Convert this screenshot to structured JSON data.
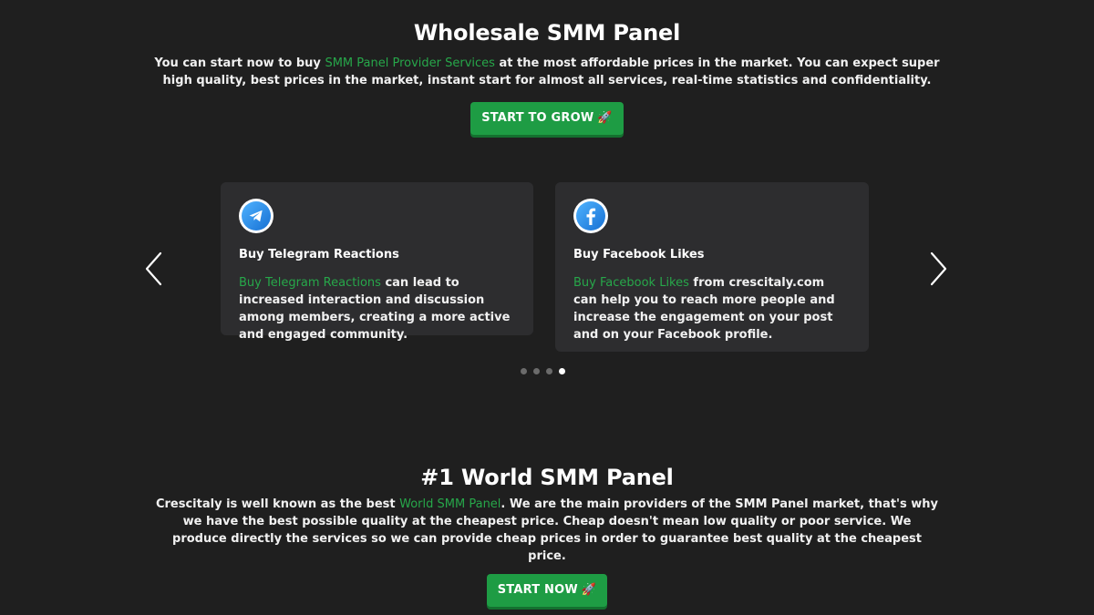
{
  "hero": {
    "title": "Wholesale SMM Panel",
    "text_before": "You can start now to buy ",
    "link": "SMM Panel Provider Services",
    "text_after": " at the most affordable prices in the market. You can expect super high quality, best prices in the market, instant start for almost all services, real-time statistics and confidentiality.",
    "button_label": "START TO GROW",
    "button_icon": "🚀"
  },
  "carousel": {
    "prev_icon": "chevron-left-icon",
    "next_icon": "chevron-right-icon",
    "cards": [
      {
        "icon": "telegram-icon",
        "title": "Buy Telegram Reactions",
        "link": "Buy Telegram Reactions",
        "text": " can lead to increased interaction and discussion among members, creating a more active and engaged community."
      },
      {
        "icon": "facebook-icon",
        "title": "Buy Facebook Likes",
        "link": "Buy Facebook Likes",
        "text": " from crescitaly.com can help you to reach more people and increase the engagement on your post and on your Facebook profile."
      }
    ],
    "dots_total": 4,
    "active_dot": 4
  },
  "world": {
    "title": "#1 World SMM Panel",
    "text_before": "Crescitaly is well known as the best ",
    "link": "World SMM Panel",
    "text_after": ". We are the main providers of the SMM Panel market, that's why we have the best possible quality at the cheapest price. Cheap doesn't mean low quality or poor service. We produce directly the services so we can provide cheap prices in order to guarantee best quality at the cheapest price.",
    "button_label": "START NOW",
    "button_icon": "🚀"
  },
  "colors": {
    "background": "#1f1f1f",
    "card": "#2d2d2f",
    "accent_green": "#1e9c44",
    "link_green": "#27a74a"
  }
}
